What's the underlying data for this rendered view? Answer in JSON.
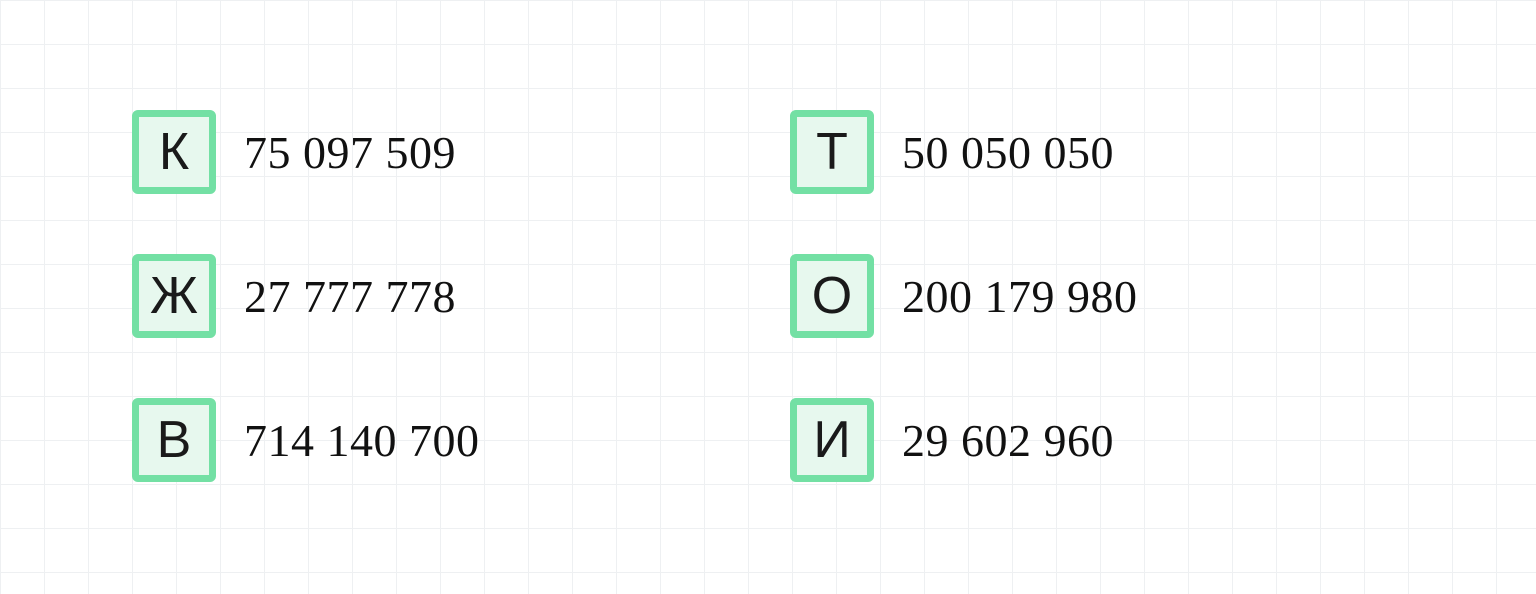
{
  "left": [
    {
      "letter": "К",
      "value": "75 097 509"
    },
    {
      "letter": "Ж",
      "value": "27 777 778"
    },
    {
      "letter": "В",
      "value": "714 140 700"
    }
  ],
  "right": [
    {
      "letter": "Т",
      "value": "50 050 050"
    },
    {
      "letter": "О",
      "value": "200 179 980"
    },
    {
      "letter": "И",
      "value": "29 602 960"
    }
  ]
}
